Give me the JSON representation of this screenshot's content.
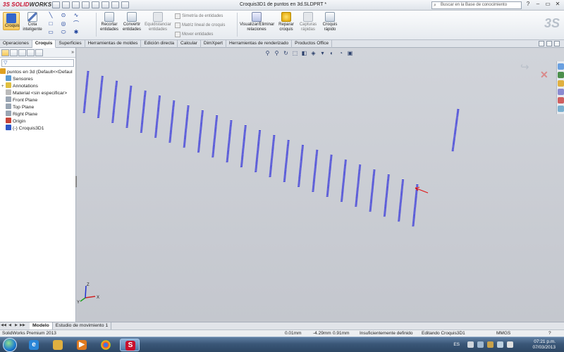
{
  "app": {
    "brand_prefix": "3S",
    "brand_bold": "SOLID",
    "brand_rest": "WORKS",
    "document_title": "Croquis3D1 de puntos en 3d.SLDPRT *",
    "search_placeholder": "Buscar en la Base de conocimiento",
    "win_help": "?",
    "win_min": "–",
    "win_restore": "▭",
    "win_close": "✕"
  },
  "ribbon": {
    "sketch_label": "Croquis",
    "smart_dim_label": "Cota inteligente",
    "trim_label": "Recortar entidades",
    "convert_label": "Convertir entidades",
    "offset_label": "Equidistanciar entidades",
    "mirror_label": "Simetría de entidades",
    "linear_pattern_label": "Matriz lineal de croquis",
    "move_label": "Mover entidades",
    "relations_label": "Visualizar/Eliminar relaciones",
    "repair_label": "Reparar croquis",
    "quick_snaps_label": "Capturas rápidas",
    "rapid_sketch_label": "Croquis rápido",
    "tools_row1": [
      "╲",
      "⊙",
      "∿"
    ],
    "tools_row2": [
      "□",
      "◎",
      "⌒"
    ],
    "tools_row3": [
      "▭",
      "⬭",
      "✱"
    ]
  },
  "tabs": [
    "Operaciones",
    "Croquis",
    "Superficies",
    "Herramientas de moldes",
    "Edición directa",
    "Calcular",
    "DimXpert",
    "Herramientas de renderizado",
    "Productos Office"
  ],
  "active_tab": "Croquis",
  "feature_tree": {
    "expand_glyph": "»",
    "filter_glyph": "▽",
    "root": "puntos en 3d  (Default<<Defaul",
    "items": [
      {
        "label": "Sensores",
        "expand": ""
      },
      {
        "label": "Annotations",
        "expand": "+"
      },
      {
        "label": "Material <sin especificar>",
        "expand": ""
      },
      {
        "label": "Front Plane",
        "expand": ""
      },
      {
        "label": "Top Plane",
        "expand": ""
      },
      {
        "label": "Right Plane",
        "expand": ""
      },
      {
        "label": "Origin",
        "expand": ""
      },
      {
        "label": "(-) Croquis3D1",
        "expand": ""
      }
    ]
  },
  "viewport": {
    "heads_up": [
      "⚲",
      "⚲",
      "↻",
      "⬚",
      "◧",
      "◈",
      "▾",
      "◐",
      "◔",
      "▣"
    ],
    "sketch_color": "#1a1adc",
    "triad_x": "X",
    "triad_y": "Y",
    "triad_z": "Z",
    "confirm_ok": "↪",
    "confirm_cancel": "✕"
  },
  "bottom_tabs": {
    "nav": [
      "◀◀",
      "◀",
      "▶",
      "▶▶"
    ],
    "tabs": [
      "Modelo",
      "Estudio de movimiento 1"
    ],
    "active": "Modelo"
  },
  "status": {
    "product": "SolidWorks Premium 2013",
    "x": "0.01mm",
    "y": "-4.29mm",
    "z": "0.91mm",
    "defined": "Insuficientemente definido",
    "editing": "Editando Croquis3D1",
    "units": "MMGS",
    "help": "?"
  },
  "taskbar": {
    "language": "ES",
    "time": "07:21 p.m.",
    "date": "07/03/2013"
  }
}
